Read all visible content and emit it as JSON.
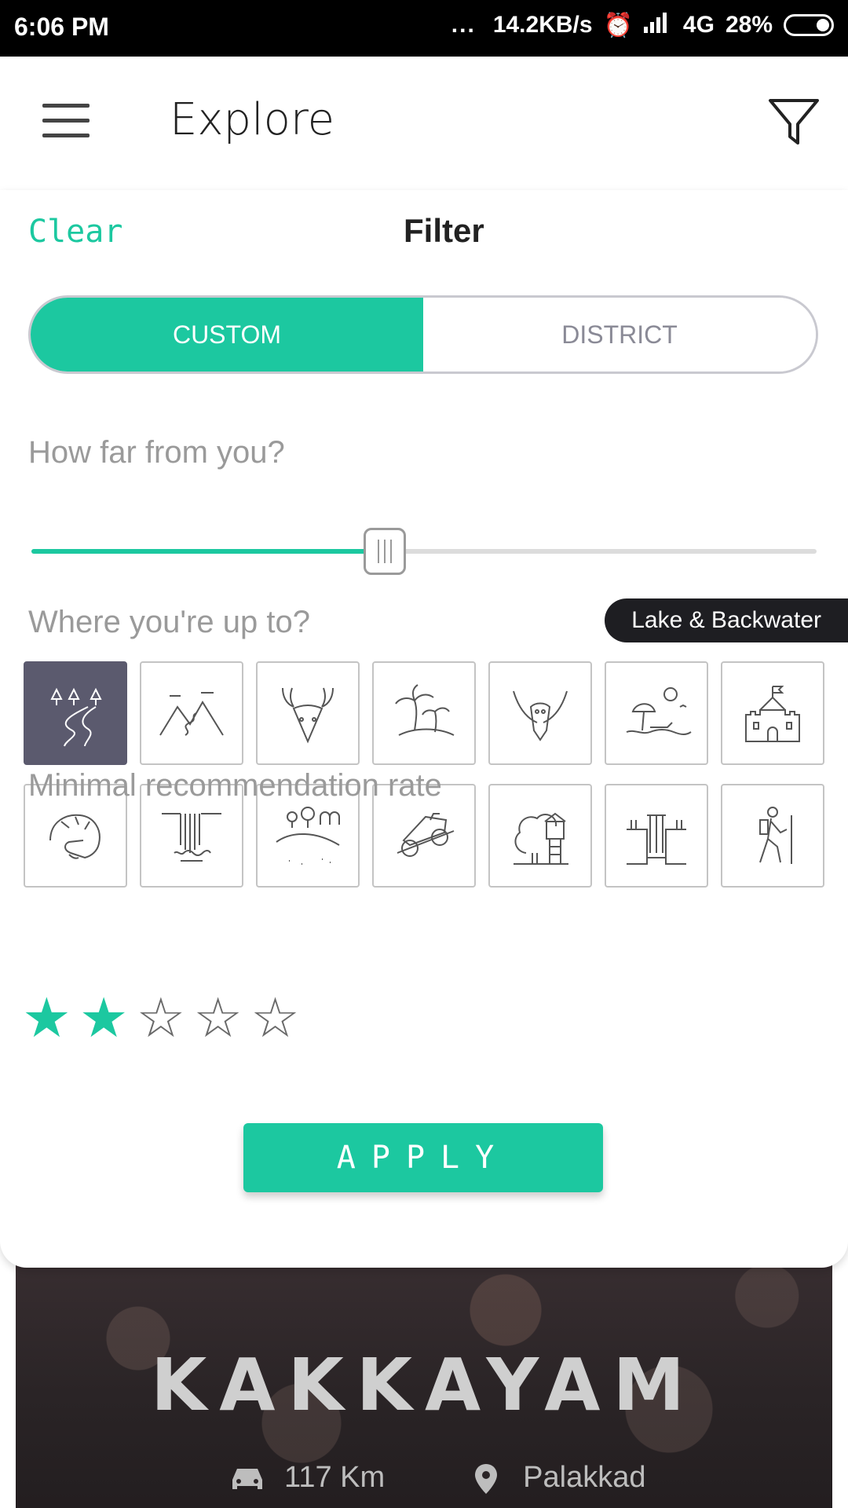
{
  "status_bar": {
    "time": "6:06 PM",
    "dots": "...",
    "speed": "14.2KB/s",
    "network": "4G",
    "battery": "28%"
  },
  "app_bar": {
    "title": "Explore"
  },
  "filter": {
    "clear_label": "Clear",
    "title": "Filter",
    "tabs": [
      {
        "label": "CUSTOM",
        "active": true
      },
      {
        "label": "DISTRICT",
        "active": false
      }
    ],
    "distance_label": "How far from you?",
    "distance_value": 0.45,
    "category_label": "Where you're up to?",
    "tooltip": "Lake & Backwater",
    "categories": [
      "lake-backwater-icon",
      "hills-icon",
      "wildlife-icon",
      "island-icon",
      "bird-icon",
      "beach-icon",
      "fort-icon",
      "adventure-helmet-icon",
      "waterfall-icon",
      "meadow-icon",
      "offroad-jeep-icon",
      "tree-house-icon",
      "canyon-waterfall-icon",
      "hiking-icon"
    ],
    "selected_category": 0,
    "rating_label": "Minimal recommendation rate",
    "rating": 2,
    "rating_max": 5,
    "apply_label": "APPLY"
  },
  "card": {
    "title": "KAKKAYAM",
    "distance": "117 Km",
    "location": "Palakkad"
  },
  "colors": {
    "accent": "#1cc8a0",
    "selected_tile": "#5b5a6e",
    "tooltip_bg": "#1e1e22"
  }
}
